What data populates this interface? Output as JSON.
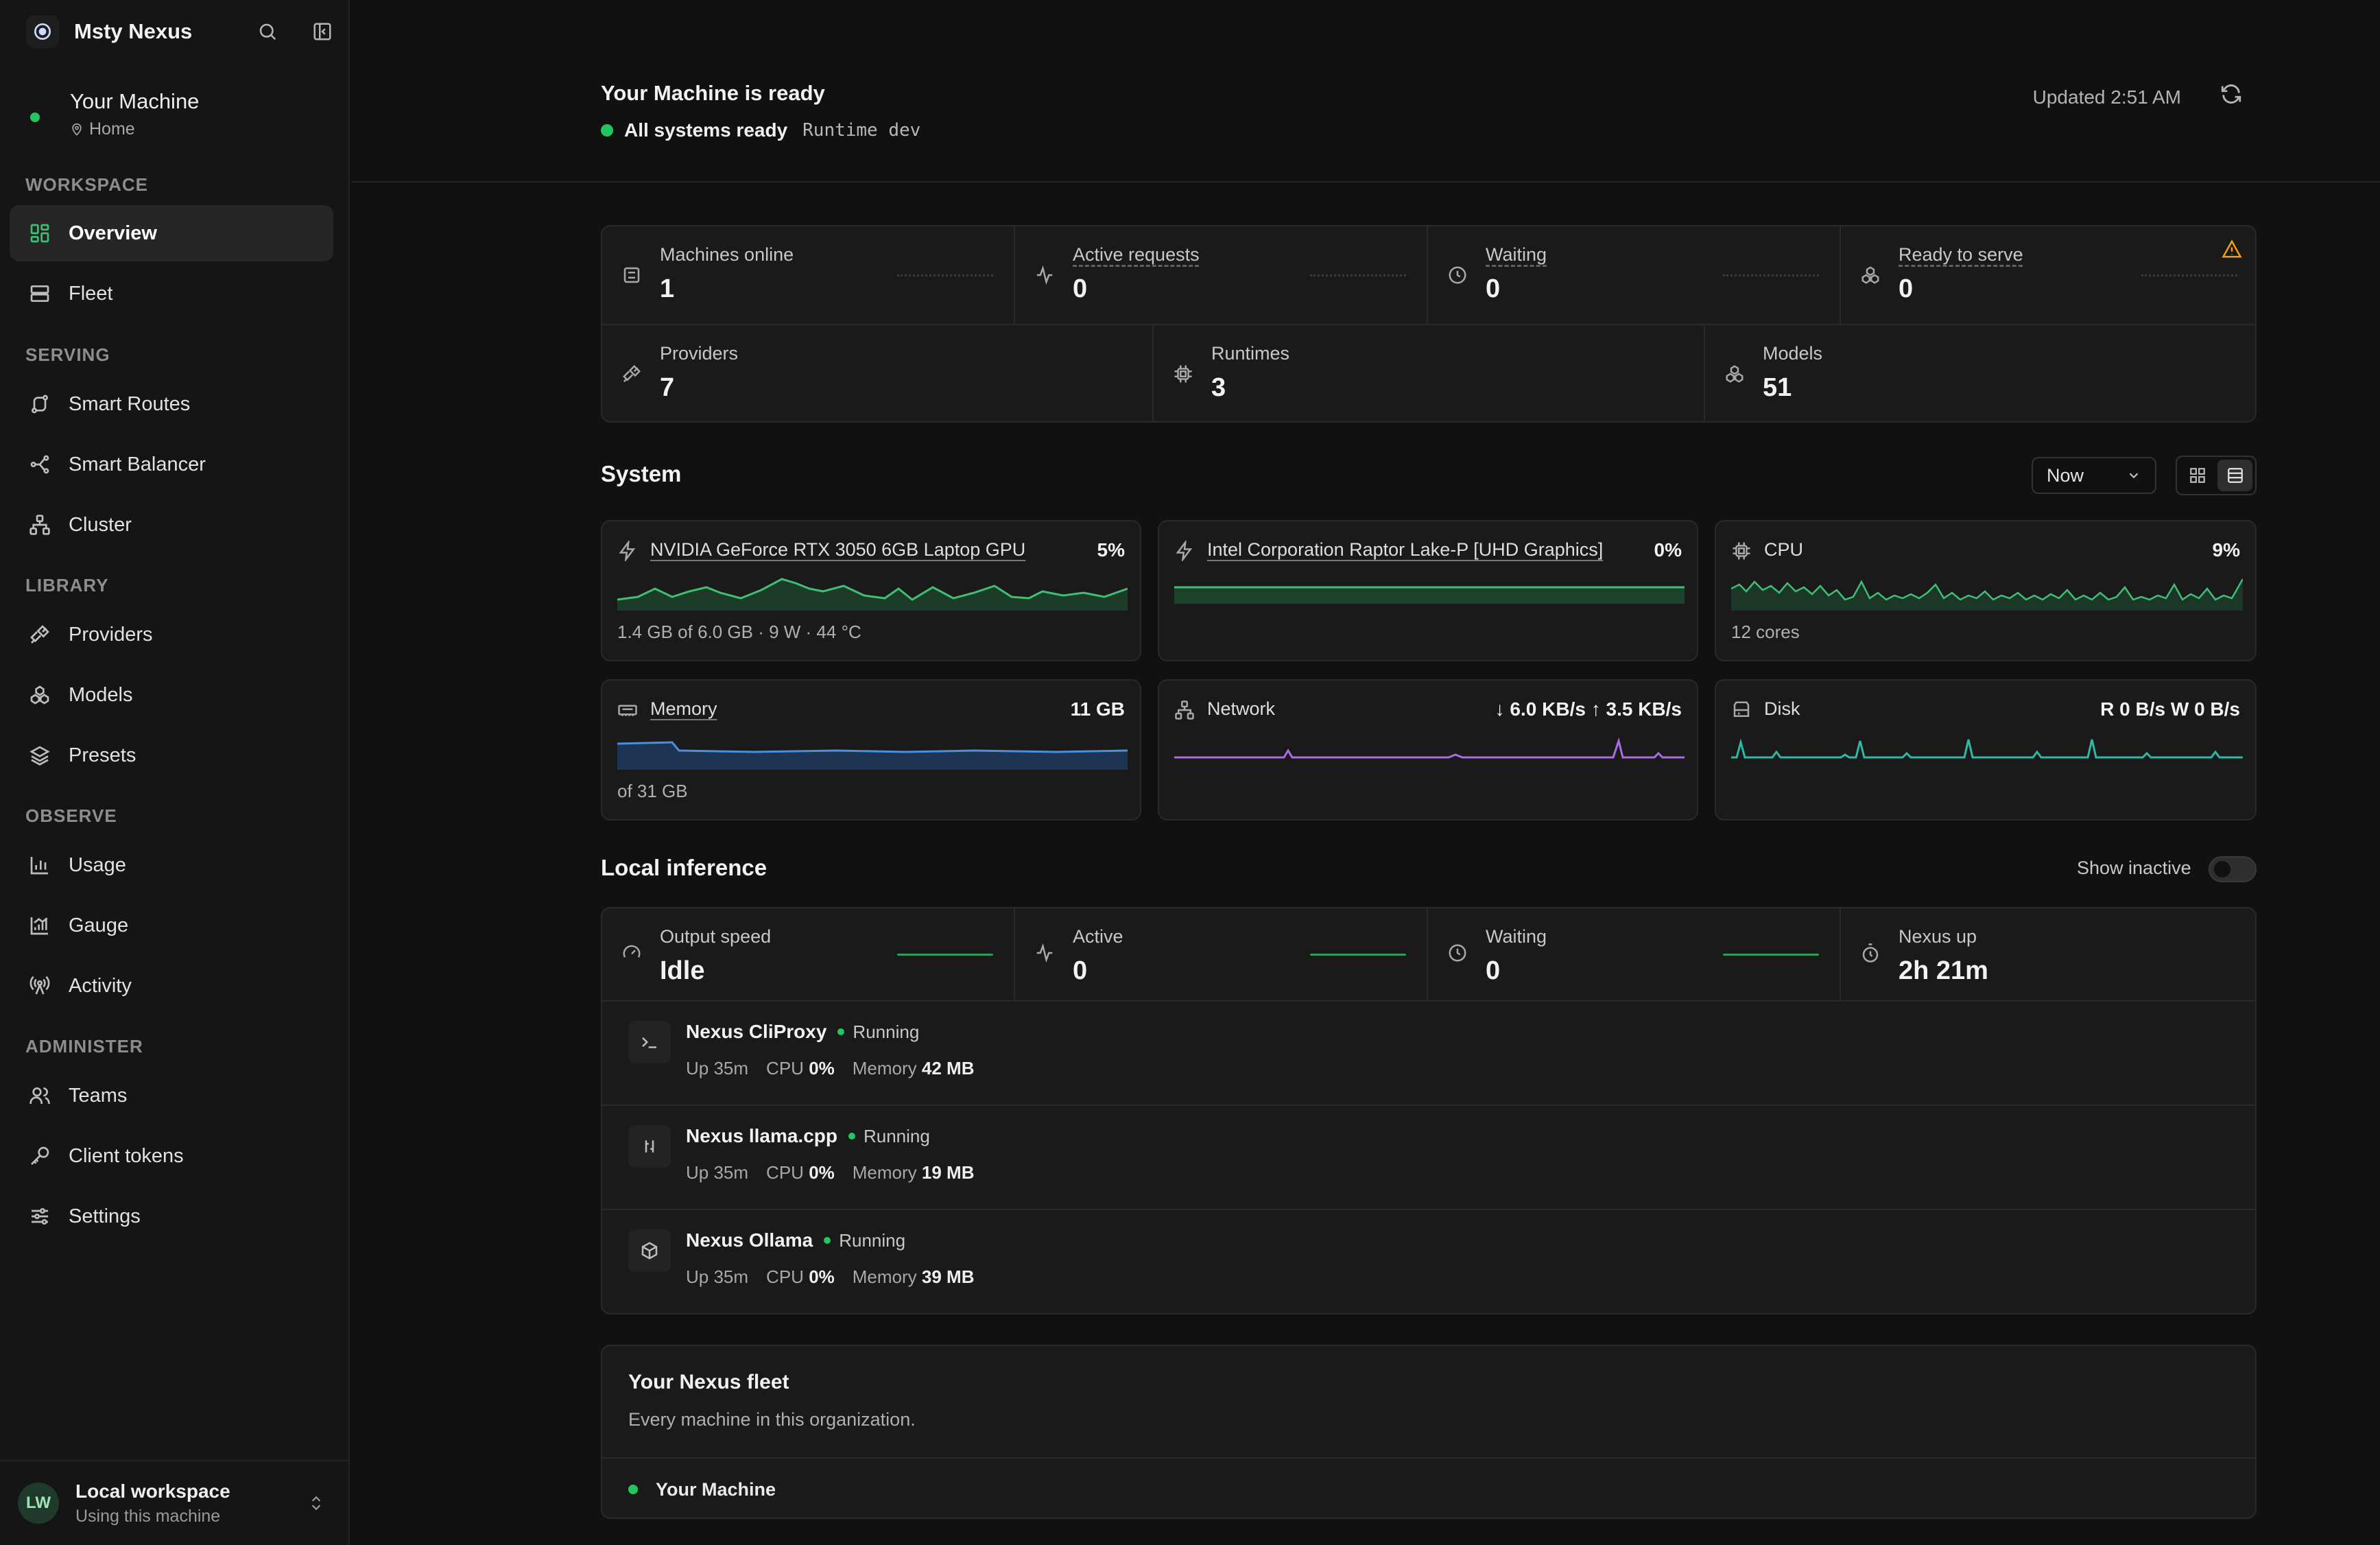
{
  "app": {
    "name": "Msty Nexus"
  },
  "machine": {
    "name": "Your Machine",
    "location": "Home"
  },
  "nav": {
    "sections": [
      {
        "label": "WORKSPACE",
        "items": [
          {
            "label": "Overview",
            "icon": "grid-icon",
            "active": true
          },
          {
            "label": "Fleet",
            "icon": "server-icon"
          }
        ]
      },
      {
        "label": "SERVING",
        "items": [
          {
            "label": "Smart Routes",
            "icon": "route-icon"
          },
          {
            "label": "Smart Balancer",
            "icon": "balancer-icon"
          },
          {
            "label": "Cluster",
            "icon": "cluster-icon"
          }
        ]
      },
      {
        "label": "LIBRARY",
        "items": [
          {
            "label": "Providers",
            "icon": "plug-icon"
          },
          {
            "label": "Models",
            "icon": "models-icon"
          },
          {
            "label": "Presets",
            "icon": "layers-icon"
          }
        ]
      },
      {
        "label": "OBSERVE",
        "items": [
          {
            "label": "Usage",
            "icon": "bar-chart-icon"
          },
          {
            "label": "Gauge",
            "icon": "gauge-icon"
          },
          {
            "label": "Activity",
            "icon": "radio-tower-icon"
          }
        ]
      },
      {
        "label": "ADMINISTER",
        "items": [
          {
            "label": "Teams",
            "icon": "users-icon"
          },
          {
            "label": "Client tokens",
            "icon": "key-icon"
          },
          {
            "label": "Settings",
            "icon": "sliders-icon"
          }
        ]
      }
    ]
  },
  "workspace": {
    "initials": "LW",
    "title": "Local workspace",
    "subtitle": "Using this machine"
  },
  "header": {
    "title": "Your Machine is ready",
    "status": "All systems ready",
    "runtime": "Runtime dev",
    "updated": "Updated 2:51 AM"
  },
  "stats": {
    "top": [
      {
        "label": "Machines online",
        "value": "1",
        "icon": "server-icon",
        "underline": false
      },
      {
        "label": "Active requests",
        "value": "0",
        "icon": "activity-icon",
        "underline": true
      },
      {
        "label": "Waiting",
        "value": "0",
        "icon": "clock-icon",
        "underline": true
      },
      {
        "label": "Ready to serve",
        "value": "0",
        "icon": "models-icon",
        "underline": true,
        "warning": true
      }
    ],
    "bottom": [
      {
        "label": "Providers",
        "value": "7",
        "icon": "plug-icon"
      },
      {
        "label": "Runtimes",
        "value": "3",
        "icon": "chip-icon"
      },
      {
        "label": "Models",
        "value": "51",
        "icon": "models-icon"
      }
    ]
  },
  "system": {
    "title": "System",
    "range": "Now",
    "cards": [
      {
        "title": "NVIDIA GeForce RTX 3050 6GB Laptop GPU",
        "value": "5%",
        "sub": "1.4 GB of 6.0 GB · 9 W · 44 °C",
        "icon": "bolt-icon",
        "color": "#3fbf74",
        "underline": true
      },
      {
        "title": "Intel Corporation Raptor Lake-P [UHD Graphics]",
        "value": "0%",
        "sub": "",
        "icon": "bolt-icon",
        "color": "#3fbf74",
        "underline": true
      },
      {
        "title": "CPU",
        "value": "9%",
        "sub": "12 cores",
        "icon": "chip-icon",
        "color": "#3fbf74",
        "underline": false
      },
      {
        "title": "Memory",
        "value": "11 GB",
        "sub": "of 31 GB",
        "icon": "memory-icon",
        "color": "#4a90e2",
        "underline": true
      },
      {
        "title": "Network",
        "value": "↓ 6.0 KB/s ↑ 3.5 KB/s",
        "sub": "",
        "icon": "network-icon",
        "color": "#a66ee0",
        "underline": false
      },
      {
        "title": "Disk",
        "value": "R 0 B/s W 0 B/s",
        "sub": "",
        "icon": "disk-icon",
        "color": "#2fb8a6",
        "underline": false
      }
    ]
  },
  "inference": {
    "title": "Local inference",
    "show_inactive": "Show inactive",
    "stats": [
      {
        "label": "Output speed",
        "value": "Idle",
        "icon": "speed-icon"
      },
      {
        "label": "Active",
        "value": "0",
        "icon": "activity-icon"
      },
      {
        "label": "Waiting",
        "value": "0",
        "icon": "clock-icon"
      },
      {
        "label": "Nexus up",
        "value": "2h 21m",
        "icon": "timer-icon"
      }
    ],
    "processes": [
      {
        "name": "Nexus CliProxy",
        "status": "Running",
        "up": "Up 35m",
        "cpu_label": "CPU",
        "cpu": "0%",
        "mem_label": "Memory",
        "mem": "42 MB",
        "icon": "terminal-icon"
      },
      {
        "name": "Nexus llama.cpp",
        "status": "Running",
        "up": "Up 35m",
        "cpu_label": "CPU",
        "cpu": "0%",
        "mem_label": "Memory",
        "mem": "19 MB",
        "icon": "llama-icon"
      },
      {
        "name": "Nexus Ollama",
        "status": "Running",
        "up": "Up 35m",
        "cpu_label": "CPU",
        "cpu": "0%",
        "mem_label": "Memory",
        "mem": "39 MB",
        "icon": "box-icon"
      }
    ]
  },
  "fleet": {
    "title": "Your Nexus fleet",
    "subtitle": "Every machine in this organization.",
    "machines": [
      {
        "name": "Your Machine"
      }
    ]
  },
  "colors": {
    "accent": "#22c55e",
    "warning": "#f59e0b",
    "background": "#111111",
    "panel": "#1a1a1a"
  }
}
